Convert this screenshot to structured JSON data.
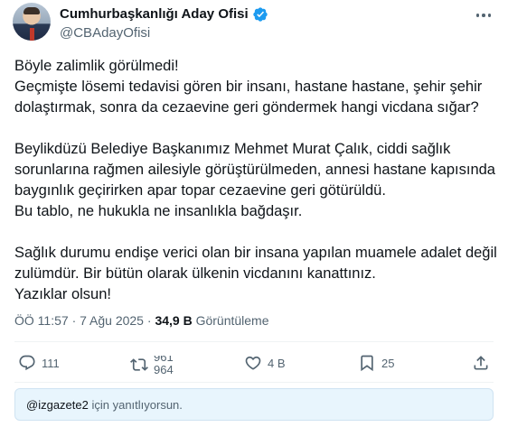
{
  "author": {
    "name": "Cumhurbaşkanlığı Aday Ofisi",
    "handle": "@CBAdayOfisi",
    "verified": true
  },
  "tweet": {
    "paragraphs": [
      "Böyle zalimlik görülmedi!\nGeçmişte lösemi tedavisi gören bir insanı, hastane hastane, şehir şehir dolaştırmak, sonra da cezaevine geri göndermek hangi vicdana sığar?",
      "Beylikdüzü Belediye Başkanımız Mehmet Murat Çalık, ciddi sağlık sorunlarına rağmen ailesiyle görüştürülmeden, annesi hastane kapısında baygınlık geçirirken apar topar cezaevine geri götürüldü.\nBu tablo, ne hukukla ne insanlıkla bağdaşır.",
      "Sağlık durumu endişe verici olan bir insana yapılan muamele adalet değil zulümdür. Bir bütün olarak ülkenin vicdanını kanattınız.\nYazıklar olsun!"
    ]
  },
  "meta": {
    "time": "ÖÖ 11:57",
    "date": "7 Ağu 2025",
    "separator": "·",
    "views_count": "34,9 B",
    "views_label": "Görüntüleme"
  },
  "actions": {
    "replies": "111",
    "reposts_old": "961",
    "reposts": "964",
    "likes": "4 B",
    "bookmarks": "25"
  },
  "reply_box": {
    "mention": "@izgazete2",
    "text": " için yanıtlıyorsun."
  },
  "colors": {
    "text": "#0f1419",
    "secondary": "#536471",
    "verified": "#1d9bf0",
    "reply_bg": "#e8f5fd"
  }
}
